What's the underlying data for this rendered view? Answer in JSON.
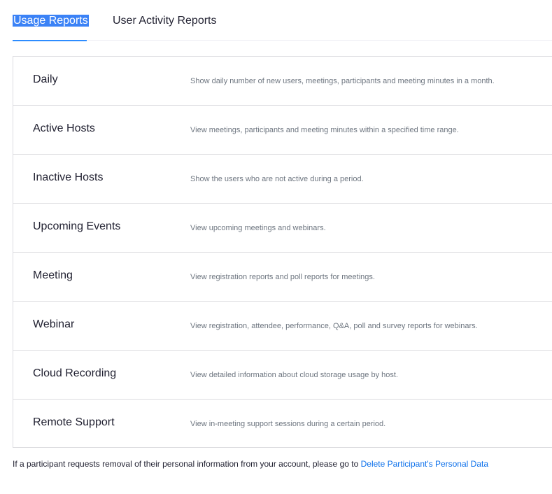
{
  "tabs": [
    {
      "label": "Usage Reports",
      "active": true
    },
    {
      "label": "User Activity Reports",
      "active": false
    }
  ],
  "reports": [
    {
      "name": "Daily",
      "description": "Show daily number of new users, meetings, participants and meeting minutes in a month."
    },
    {
      "name": "Active Hosts",
      "description": "View meetings, participants and meeting minutes within a specified time range."
    },
    {
      "name": "Inactive Hosts",
      "description": "Show the users who are not active during a period."
    },
    {
      "name": "Upcoming Events",
      "description": "View upcoming meetings and webinars."
    },
    {
      "name": "Meeting",
      "description": "View registration reports and poll reports for meetings."
    },
    {
      "name": "Webinar",
      "description": "View registration, attendee, performance, Q&A, poll and survey reports for webinars."
    },
    {
      "name": "Cloud Recording",
      "description": "View detailed information about cloud storage usage by host."
    },
    {
      "name": "Remote Support",
      "description": "View in-meeting support sessions during a certain period."
    }
  ],
  "footer": {
    "text": "If a participant requests removal of their personal information from your account, please go to",
    "link_label": "Delete Participant's Personal Data"
  },
  "colors": {
    "accent": "#2d8cff",
    "link": "#0e71eb",
    "selection_highlight": "#3b82f6"
  }
}
